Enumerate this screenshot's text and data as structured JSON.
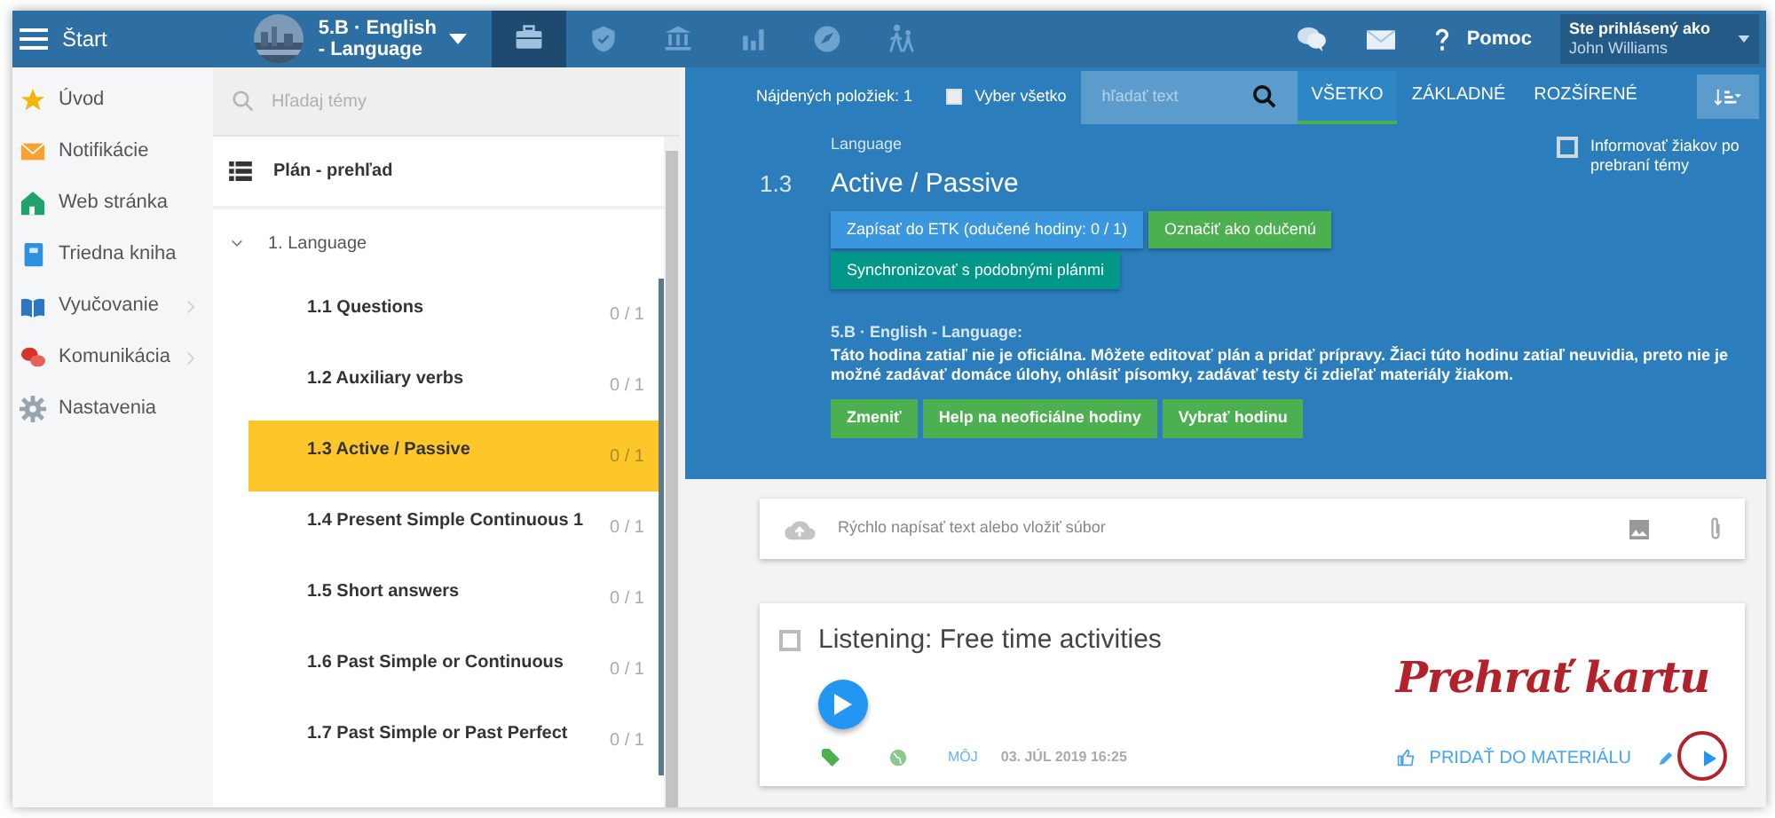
{
  "header": {
    "menu_label": "Štart",
    "class_selector": {
      "label": "5.B · English - Language"
    },
    "nav_tabs": [
      {
        "selected": true
      },
      {
        "selected": false
      },
      {
        "selected": false
      },
      {
        "selected": false
      },
      {
        "selected": false
      },
      {
        "selected": false
      }
    ],
    "help_label": "Pomoc",
    "user": {
      "caption": "Ste prihlásený ako",
      "name": "John Williams"
    }
  },
  "sidebar": {
    "items": [
      {
        "label": "Úvod",
        "has_submenu": false
      },
      {
        "label": "Notifikácie",
        "has_submenu": false
      },
      {
        "label": "Web stránka",
        "has_submenu": false
      },
      {
        "label": "Triedna kniha",
        "has_submenu": false
      },
      {
        "label": "Vyučovanie",
        "has_submenu": true
      },
      {
        "label": "Komunikácia",
        "has_submenu": true
      },
      {
        "label": "Nastavenia",
        "has_submenu": false
      }
    ]
  },
  "topics": {
    "search_placeholder": "Hľadaj témy",
    "overview_label": "Plán - prehľad",
    "section": {
      "label": "1. Language",
      "expanded": true,
      "children": [
        {
          "number": "1.1",
          "label": "Questions",
          "count": "0 / 1",
          "selected": false
        },
        {
          "number": "1.2",
          "label": "Auxiliary verbs",
          "count": "0 / 1",
          "selected": false
        },
        {
          "number": "1.3",
          "label": "Active / Passive",
          "count": "0 / 1",
          "selected": true
        },
        {
          "number": "1.4",
          "label": "Present Simple Continuous 1",
          "count": "0 / 1",
          "selected": false
        },
        {
          "number": "1.5",
          "label": "Short answers",
          "count": "0 / 1",
          "selected": false
        },
        {
          "number": "1.6",
          "label": "Past Simple or Continuous",
          "count": "0 / 1",
          "selected": false
        },
        {
          "number": "1.7",
          "label": "Past Simple or Past Perfect",
          "count": "0 / 1",
          "selected": false
        }
      ]
    }
  },
  "toolbar": {
    "found": "Nájdených položiek: 1",
    "select_all": {
      "label": "Vyber všetko",
      "checked": false
    },
    "search_placeholder": "hľadať text",
    "filters": [
      {
        "label": "VŠETKO",
        "selected": true
      },
      {
        "label": "ZÁKLADNÉ",
        "selected": false
      },
      {
        "label": "ROZŠÍRENÉ",
        "selected": false
      }
    ]
  },
  "topic": {
    "category": "Language",
    "number": "1.3",
    "title": "Active / Passive",
    "inform": {
      "label": "Informovať žiakov po prebraní témy",
      "checked": false
    },
    "buttons": [
      {
        "label": "Zapísať do ETK (odučené hodiny: 0 / 1)",
        "kind": "blue"
      },
      {
        "label": "Označiť ako odučenú",
        "kind": "green"
      },
      {
        "label": "Synchronizovať s podobnými plánmi",
        "kind": "teal"
      }
    ],
    "notice": {
      "heading": "5.B · English - Language:",
      "text": "Táto hodina zatiaľ nie je oficiálna. Môžete editovať plán a pridať prípravy. Žiaci túto hodinu zatiaľ neuvidia, preto nie je možné zadávať domáce úlohy, ohlásiť písomky, zadávať testy či zdieľať materiály žiakom.",
      "buttons": [
        "Zmeniť",
        "Help na neoficiálne hodiny",
        "Vybrať hodinu"
      ]
    }
  },
  "quick_post": {
    "placeholder": "Rýchlo napísať text alebo vložiť súbor"
  },
  "card": {
    "title": "Listening: Free time activities",
    "checked": false,
    "owner": "MÔJ",
    "date": "03. JÚL 2019 16:25",
    "add_label": "PRIDAŤ DO MATERIÁLU"
  },
  "annotation": {
    "label": "Prehrať kartu"
  }
}
